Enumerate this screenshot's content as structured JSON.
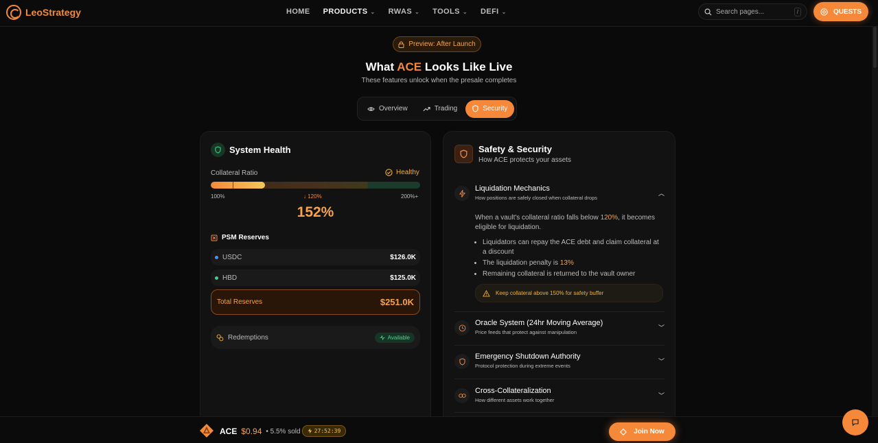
{
  "header": {
    "logo_text": "LeoStrategy",
    "nav": [
      {
        "label": "HOME"
      },
      {
        "label": "PRODUCTS"
      },
      {
        "label": "RWAS"
      },
      {
        "label": "TOOLS"
      },
      {
        "label": "DEFI"
      }
    ],
    "search_placeholder": "Search pages...",
    "search_shortcut": "/",
    "quests_label": "QUESTS"
  },
  "hero": {
    "preview_badge": "Preview: After Launch",
    "title_pre": "What ",
    "title_accent": "ACE",
    "title_post": " Looks Like Live",
    "subtitle": "These features unlock when the presale completes"
  },
  "tabs": [
    {
      "label": "Overview"
    },
    {
      "label": "Trading"
    },
    {
      "label": "Security",
      "active": true
    }
  ],
  "system_health": {
    "title": "System Health",
    "collateral_label": "Collateral Ratio",
    "status": "Healthy",
    "ratio_fill_fraction": 0.26,
    "tick_min": "100%",
    "tick_liq": "↓ 120%",
    "tick_max": "200%+",
    "ratio_value": "152%",
    "psm_title": "PSM Reserves",
    "reserves": [
      {
        "name": "USDC",
        "value": "$126.0K",
        "color": "#4f8ef7"
      },
      {
        "name": "HBD",
        "value": "$125.0K",
        "color": "#3fcf8e"
      }
    ],
    "total_label": "Total Reserves",
    "total_value": "$251.0K",
    "redemptions_label": "Redemptions",
    "redemptions_status": "Available"
  },
  "safety": {
    "title": "Safety & Security",
    "subtitle": "How ACE protects your assets",
    "sections": [
      {
        "title": "Liquidation Mechanics",
        "sub": "How positions are safely closed when collateral drops",
        "expanded": true
      },
      {
        "title": "Oracle System (24hr Moving Average)",
        "sub": "Price feeds that protect against manipulation"
      },
      {
        "title": "Emergency Shutdown Authority",
        "sub": "Protocol protection during extreme events"
      },
      {
        "title": "Cross-Collateralization",
        "sub": "How different assets work together"
      }
    ],
    "liquidation": {
      "intro_a": "When a vault's collateral ratio falls below ",
      "intro_hl": "120%",
      "intro_b": ", it becomes eligible for liquidation.",
      "bullet1": "Liquidators can repay the ACE debt and claim collateral at a discount",
      "bullet2_a": "The liquidation penalty is ",
      "bullet2_hl": "13%",
      "bullet3": "Remaining collateral is returned to the vault owner",
      "warning": "Keep collateral above 150% for safety buffer"
    }
  },
  "footer": {
    "token": "ACE",
    "price": "$0.94",
    "sold": "• 5.5% sold",
    "timer": "27:52:39",
    "join_label": "Join Now"
  },
  "colors": {
    "accent": "#f6883a",
    "healthy": "#f2b13c",
    "available": "#57cf8e"
  }
}
